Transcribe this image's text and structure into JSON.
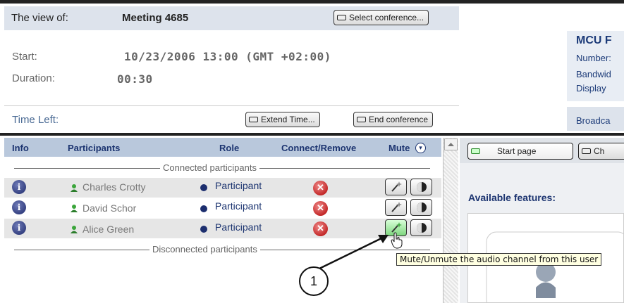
{
  "header": {
    "view_label": "The view of:",
    "conference_name": "Meeting 4685",
    "select_conference_label": "Select conference..."
  },
  "details": {
    "start_label": "Start:",
    "start_value": "10/23/2006 13:00 (GMT +02:00)",
    "duration_label": "Duration:",
    "duration_value": "00:30",
    "time_left_label": "Time Left:",
    "extend_time_label": "Extend Time...",
    "end_conference_label": "End conference"
  },
  "mcu": {
    "title": "MCU F",
    "items": [
      "Number:",
      "Bandwid",
      "Display",
      "Broadca"
    ]
  },
  "table": {
    "columns": [
      "Info",
      "Participants",
      "Role",
      "Connect/Remove",
      "Mute"
    ],
    "connected_label": "Connected participants",
    "disconnected_label": "Disconnected participants",
    "rows": [
      {
        "name": "Charles Crotty",
        "role": "Participant"
      },
      {
        "name": "David Schor",
        "role": "Participant"
      },
      {
        "name": "Alice Green",
        "role": "Participant"
      }
    ]
  },
  "right_panel": {
    "start_page_tab": "Start page",
    "second_tab": "Ch",
    "available_features": "Available features:"
  },
  "tooltip": "Mute/Unmute the audio channel from this user",
  "callout": "1",
  "colors": {
    "accent": "#1c3470",
    "header_band": "#dde3ec",
    "table_header": "#b9c8dc",
    "mute_active": "#7ed67e",
    "remove": "#b00000"
  }
}
